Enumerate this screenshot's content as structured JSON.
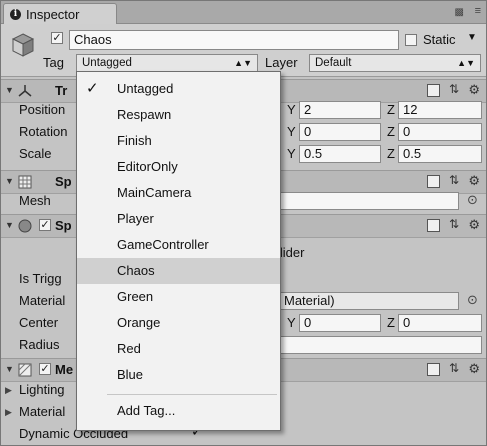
{
  "tab": {
    "title": "Inspector"
  },
  "header": {
    "object_name": "Chaos",
    "static_label": "Static",
    "tag_label": "Tag",
    "tag_value": "Untagged",
    "layer_label": "Layer",
    "layer_value": "Default"
  },
  "transform": {
    "title": "Tr",
    "rows": [
      {
        "label": "Position",
        "y": "2",
        "z": "12"
      },
      {
        "label": "Rotation",
        "y": "0",
        "z": "0"
      },
      {
        "label": "Scale",
        "y": "0.5",
        "z": "0.5"
      }
    ]
  },
  "mesh_filter": {
    "title": "Sp",
    "mesh_label": "Mesh"
  },
  "collider": {
    "title": "Sp",
    "title_suffix": "llider",
    "is_trigger_label": "Is Trigg",
    "material_label": "Material",
    "material_value": "Material)",
    "center_label": "Center",
    "center_y": "0",
    "center_z": "0",
    "radius_label": "Radius"
  },
  "renderer": {
    "title": "Me",
    "lighting_label": "Lighting",
    "materials_label": "Material",
    "dynamic_occluded_label": "Dynamic Occluded"
  },
  "axes": {
    "y": "Y",
    "z": "Z"
  },
  "tag_menu": {
    "items": [
      {
        "label": "Untagged",
        "checked": true
      },
      {
        "label": "Respawn"
      },
      {
        "label": "Finish"
      },
      {
        "label": "EditorOnly"
      },
      {
        "label": "MainCamera"
      },
      {
        "label": "Player"
      },
      {
        "label": "GameController"
      },
      {
        "label": "Chaos",
        "highlighted": true
      },
      {
        "label": "Green"
      },
      {
        "label": "Orange"
      },
      {
        "label": "Red"
      },
      {
        "label": "Blue"
      }
    ],
    "add_tag": "Add Tag..."
  }
}
